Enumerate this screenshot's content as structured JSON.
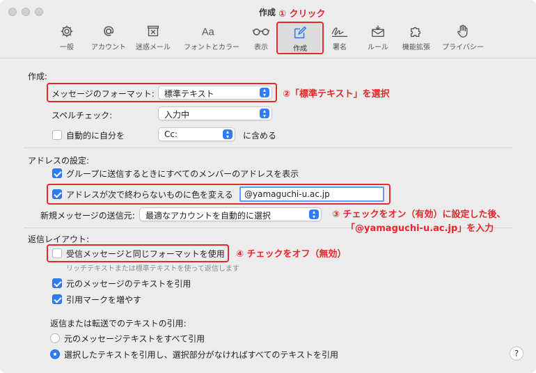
{
  "window": {
    "title": "作成"
  },
  "toolbar": {
    "items": [
      {
        "label": "一般",
        "icon": "gear-icon"
      },
      {
        "label": "アカウント",
        "icon": "at-sign-icon"
      },
      {
        "label": "迷惑メール",
        "icon": "junk-tray-icon"
      },
      {
        "label": "フォントとカラー",
        "icon": "font-aa-icon"
      },
      {
        "label": "表示",
        "icon": "glasses-icon"
      },
      {
        "label": "作成",
        "icon": "compose-pencil-icon"
      },
      {
        "label": "署名",
        "icon": "signature-icon"
      },
      {
        "label": "ルール",
        "icon": "rules-envelope-icon"
      },
      {
        "label": "機能拡張",
        "icon": "puzzle-icon"
      },
      {
        "label": "プライバシー",
        "icon": "hand-icon"
      }
    ],
    "selected": "作成"
  },
  "compose": {
    "section_label": "作成:",
    "format_label": "メッセージのフォーマット:",
    "format_value": "標準テキスト",
    "spell_label": "スペルチェック:",
    "spell_value": "入力中",
    "auto_self_label": "自動的に自分を",
    "auto_self_value": "Cc:",
    "auto_self_suffix": "に含める"
  },
  "address": {
    "section_label": "アドレスの設定:",
    "group_label": "グループに送信するときにすべてのメンバーのアドレスを表示",
    "color_label": "アドレスが次で終わらないものに色を変える",
    "domain_value": "@yamaguchi-u.ac.jp",
    "sender_label": "新規メッセージの送信元:",
    "sender_value": "最適なアカウントを自動的に選択"
  },
  "reply": {
    "section_label": "返信レイアウト:",
    "same_format_label": "受信メッセージと同じフォーマットを使用",
    "same_format_sub": "リッチテキストまたは標準テキストを使って返信します",
    "quote_label": "元のメッセージのテキストを引用",
    "increase_label": "引用マークを増やす",
    "quoting_label": "返信または転送でのテキストの引用:",
    "radio_all": "元のメッセージテキストをすべて引用",
    "radio_selected": "選択したテキストを引用し、選択部分がなければすべてのテキストを引用"
  },
  "help": {
    "label": "?"
  },
  "annotations": {
    "a1": "① クリック",
    "a2": "②「標準テキスト」を選択",
    "a3_line1": "③ チェックをオン（有効）に設定した後、",
    "a3_line2": "「@yamaguchi-u.ac.jp」を入力",
    "a4": "④ チェックをオフ（無効）"
  },
  "colors": {
    "accent": "#2f7cf6",
    "annotation": "#e8262b"
  }
}
